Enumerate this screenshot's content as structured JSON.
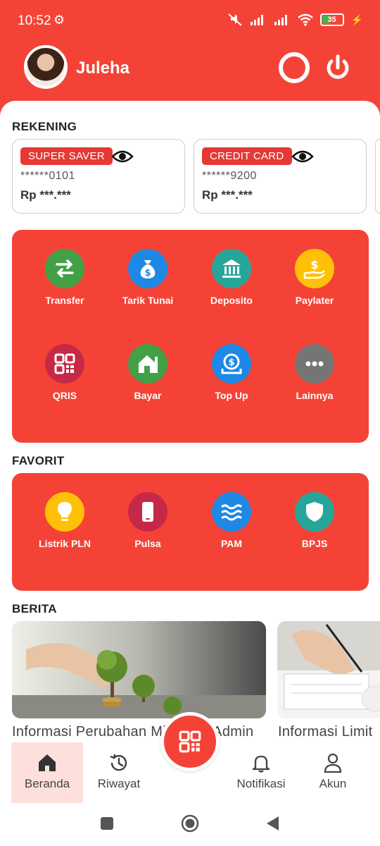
{
  "status_bar": {
    "time": "10:52",
    "battery_level": "35"
  },
  "header": {
    "user_name": "Juleha"
  },
  "accounts_section": {
    "title": "REKENING",
    "cards": [
      {
        "badge": "SUPER SAVER",
        "number": "******0101",
        "balance": "Rp ***.***"
      },
      {
        "badge": "CREDIT CARD",
        "number": "******9200",
        "balance": "Rp ***.***"
      }
    ]
  },
  "services": [
    {
      "label": "Transfer",
      "icon": "transfer-icon",
      "color": "#43a047"
    },
    {
      "label": "Tarik Tunai",
      "icon": "money-bag-icon",
      "color": "#1e88e5"
    },
    {
      "label": "Deposito",
      "icon": "bank-icon",
      "color": "#26a69a"
    },
    {
      "label": "Paylater",
      "icon": "paylater-icon",
      "color": "#ffc107"
    },
    {
      "label": "QRIS",
      "icon": "qris-icon",
      "color": "#c62848"
    },
    {
      "label": "Bayar",
      "icon": "house-icon",
      "color": "#43a047"
    },
    {
      "label": "Top Up",
      "icon": "topup-icon",
      "color": "#1e88e5"
    },
    {
      "label": "Lainnya",
      "icon": "more-icon",
      "color": "#757575"
    }
  ],
  "favorites_section": {
    "title": "FAVORIT",
    "items": [
      {
        "label": "Listrik PLN",
        "icon": "lightbulb-icon",
        "color": "#ffc107"
      },
      {
        "label": "Pulsa",
        "icon": "phone-icon",
        "color": "#c62848"
      },
      {
        "label": "PAM",
        "icon": "water-icon",
        "color": "#1e88e5"
      },
      {
        "label": "BPJS",
        "icon": "shield-icon",
        "color": "#26a69a"
      }
    ]
  },
  "news_section": {
    "title": "BERITA",
    "items": [
      {
        "title": "Informasi Perubahan Minimum Admin"
      },
      {
        "title": "Informasi Limit"
      }
    ]
  },
  "bottom_nav": {
    "items": [
      {
        "label": "Beranda",
        "icon": "home-icon",
        "active": true
      },
      {
        "label": "Riwayat",
        "icon": "history-icon",
        "active": false
      },
      {
        "label": "Notifikasi",
        "icon": "bell-icon",
        "active": false
      },
      {
        "label": "Akun",
        "icon": "person-icon",
        "active": false
      }
    ],
    "center_button_icon": "qr-scan-icon"
  },
  "colors": {
    "brand_red": "#f44336",
    "badge_red": "#e53935",
    "active_nav_bg": "#fde0dc"
  }
}
